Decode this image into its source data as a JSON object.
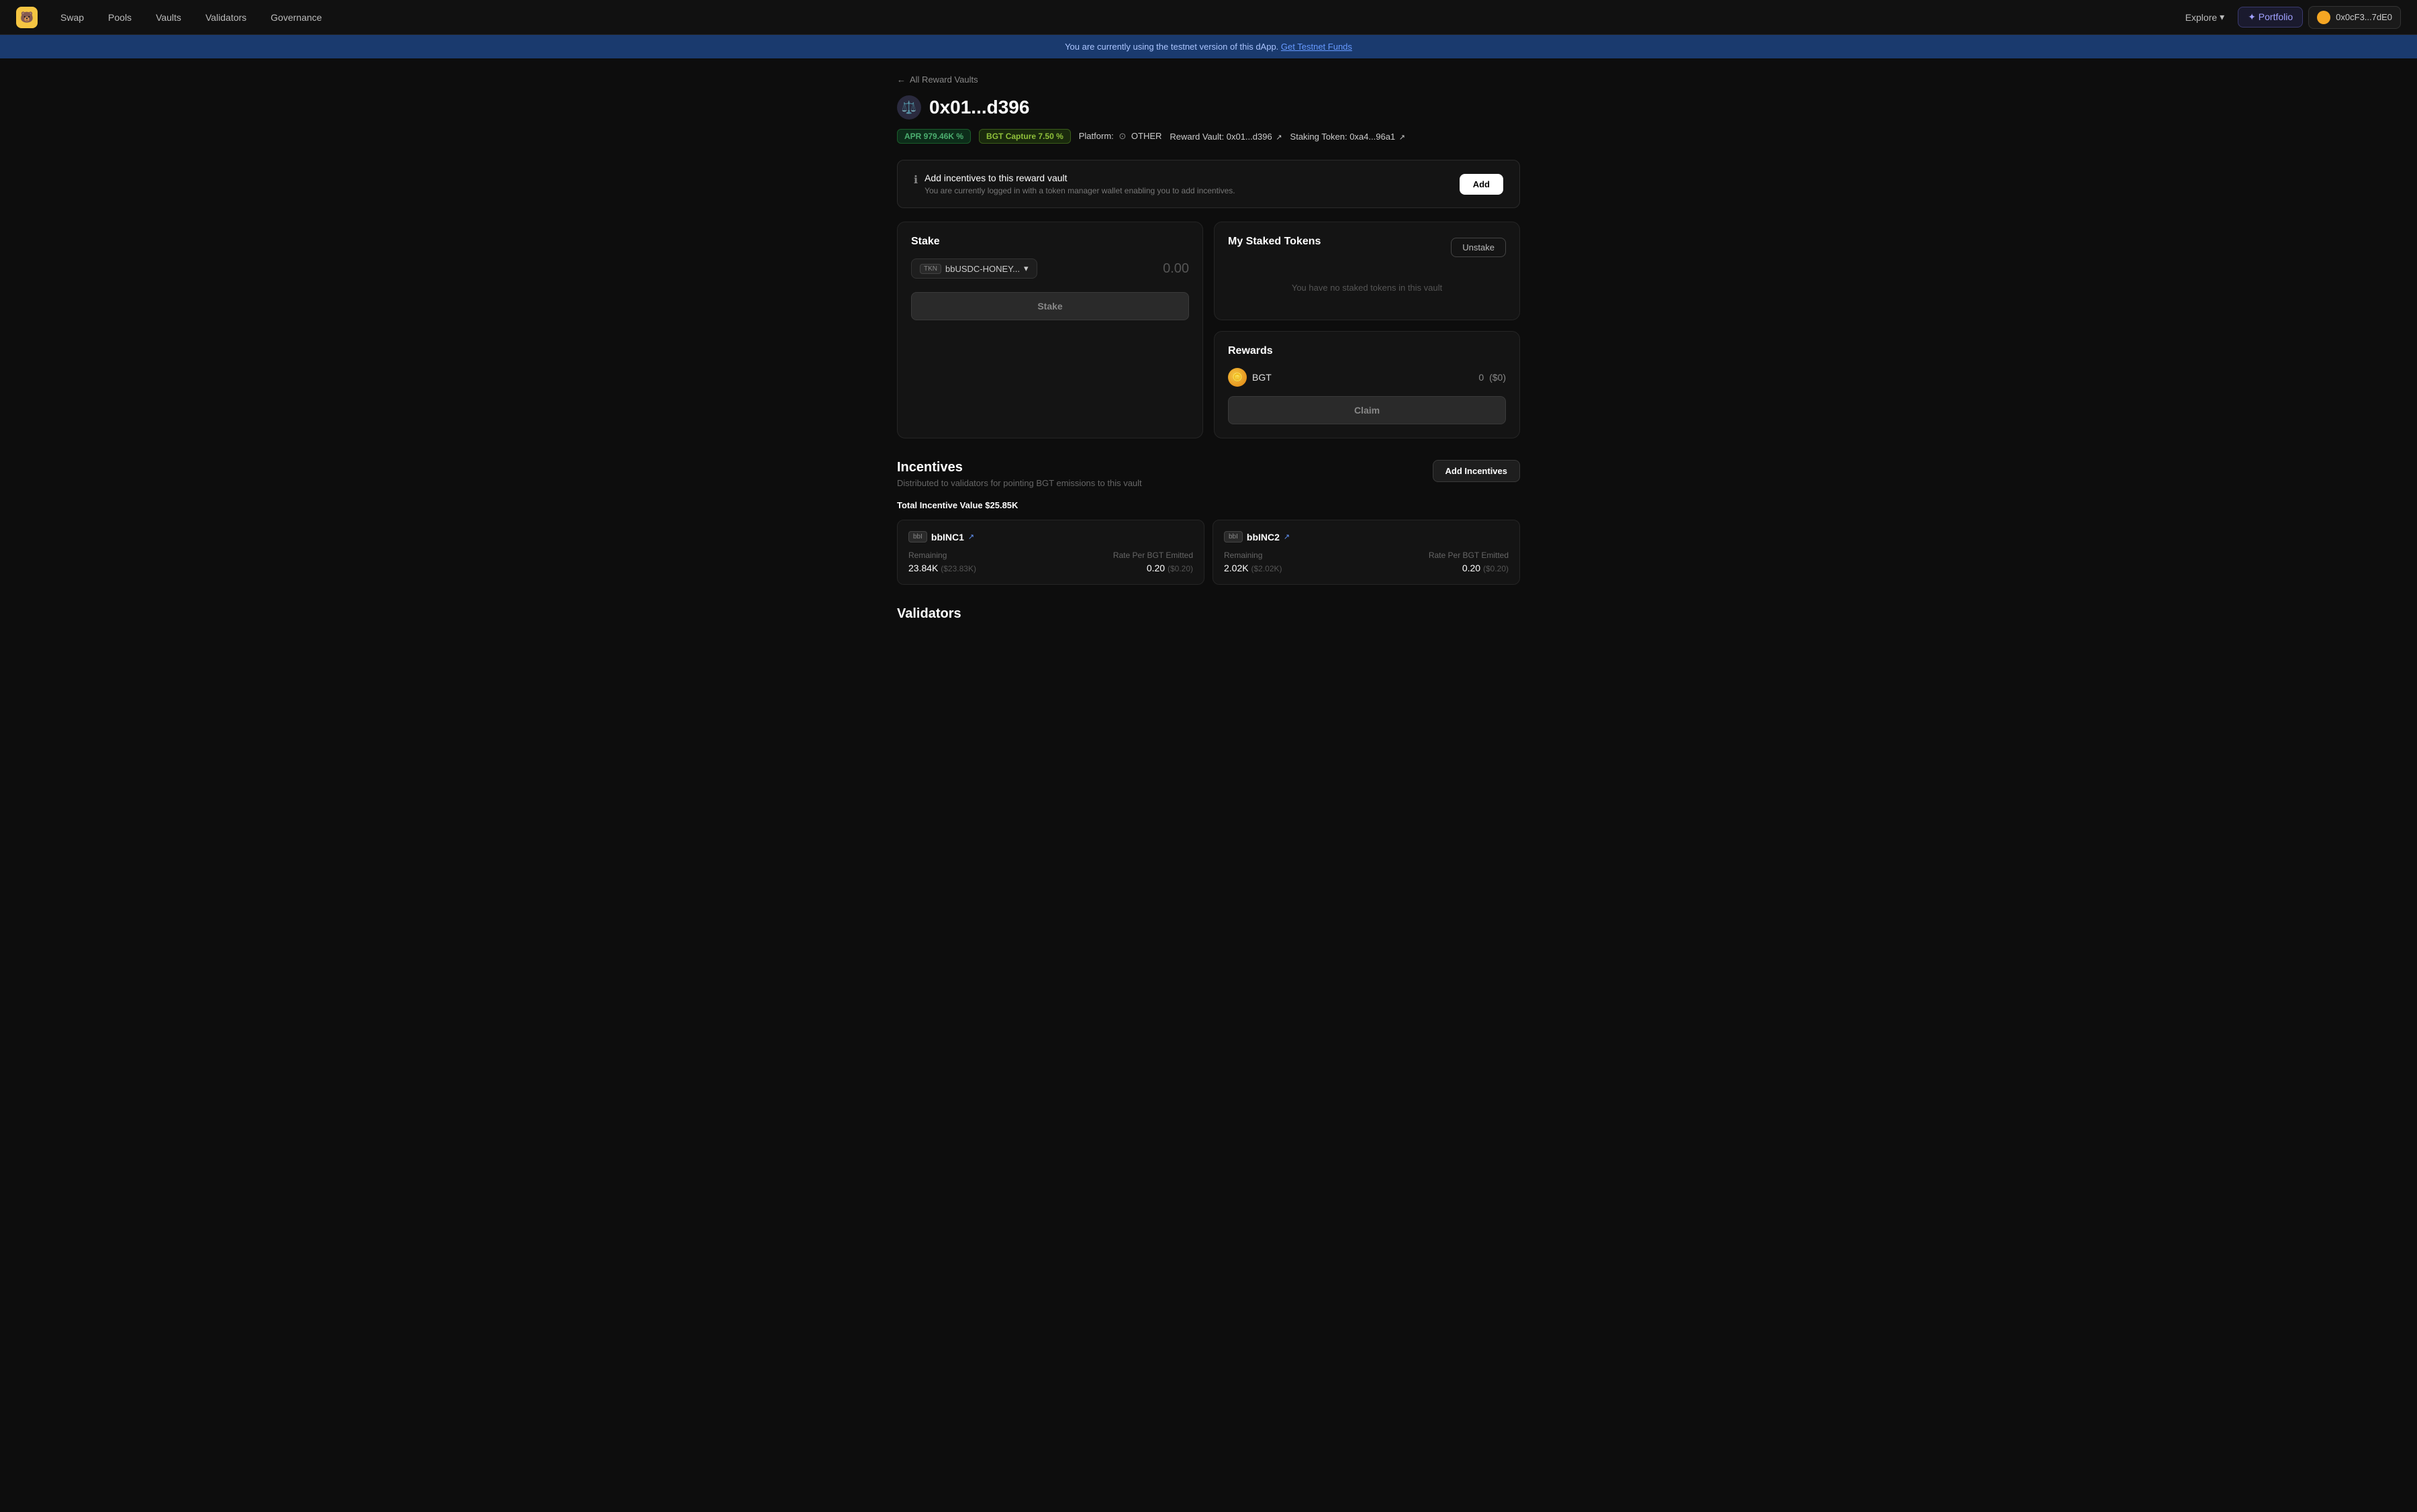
{
  "app": {
    "logo": "🐻",
    "nav": {
      "links": [
        "Swap",
        "Pools",
        "Vaults",
        "Validators",
        "Governance"
      ],
      "explore": "Explore",
      "portfolio": "✦ Portfolio",
      "wallet": "0x0cF3...7dE0"
    }
  },
  "banner": {
    "message": "You are currently using the testnet version of this dApp.",
    "link_text": "Get Testnet Funds"
  },
  "page": {
    "back_label": "All Reward Vaults",
    "vault_icon": "⚖️",
    "vault_title": "0x01...d396",
    "apr_label": "APR 979.46K %",
    "bgt_capture_label": "BGT Capture 7.50 %",
    "platform_label": "Platform:",
    "platform_value": "OTHER",
    "reward_vault_label": "Reward Vault:",
    "reward_vault_value": "0x01...d396",
    "staking_token_label": "Staking Token:",
    "staking_token_value": "0xa4...96a1"
  },
  "incentive_notice": {
    "title": "Add incentives to this reward vault",
    "description": "You are currently logged in with a token manager wallet enabling you to add incentives.",
    "button_label": "Add"
  },
  "stake_card": {
    "title": "Stake",
    "token_badge": "TKN",
    "token_name": "bbUSDC-HONEY...",
    "amount": "0.00",
    "button_label": "Stake"
  },
  "my_staked_tokens": {
    "title": "My Staked Tokens",
    "unstake_label": "Unstake",
    "empty_message": "You have no staked tokens in this vault"
  },
  "rewards": {
    "title": "Rewards",
    "token_name": "BGT",
    "amount": "0",
    "amount_usd": "($0)",
    "claim_label": "Claim"
  },
  "incentives_section": {
    "title": "Incentives",
    "description": "Distributed to validators for pointing BGT emissions to this vault",
    "add_button_label": "Add Incentives",
    "total_label": "Total Incentive Value",
    "total_value": "$25.85K",
    "tokens": [
      {
        "abbr": "bbI",
        "name": "bbINC1",
        "remaining_label": "Remaining",
        "remaining_value": "23.84K",
        "remaining_usd": "($23.83K)",
        "rate_label": "Rate Per BGT Emitted",
        "rate_value": "0.20",
        "rate_usd": "($0.20)"
      },
      {
        "abbr": "bbI",
        "name": "bbINC2",
        "remaining_label": "Remaining",
        "remaining_value": "2.02K",
        "remaining_usd": "($2.02K)",
        "rate_label": "Rate Per BGT Emitted",
        "rate_value": "0.20",
        "rate_usd": "($0.20)"
      }
    ]
  },
  "validators_section": {
    "title": "Validators"
  }
}
